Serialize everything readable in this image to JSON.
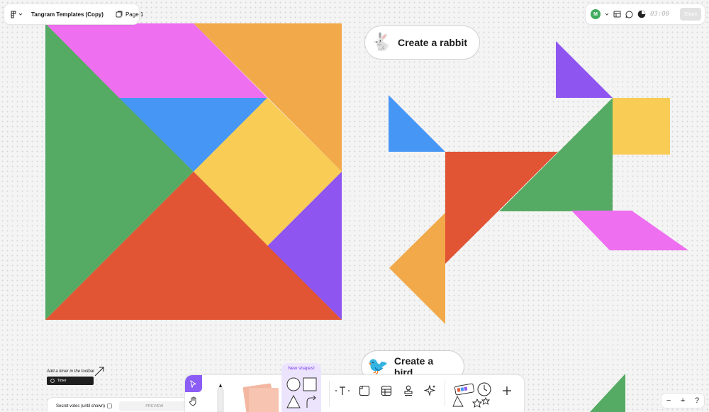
{
  "header": {
    "file_title": "Tangram Templates (Copy)",
    "page_label": "Page 1",
    "avatar_initial": "M",
    "timer_value": "03:00",
    "share_label": "Share"
  },
  "canvas": {
    "rabbit_label": "Create a rabbit",
    "rabbit_emoji": "🐇",
    "bird_label": "Create a bird",
    "bird_emoji": "🐦",
    "timer_hint": "Add a timer in the toolbar",
    "timer_chip_label": "Timer",
    "secret_votes_label": "Secret votes (until shown)",
    "preview_label": "PREVIEW"
  },
  "colors": {
    "green": "#55ab63",
    "magenta": "#ee6fef",
    "orange": "#f2a94a",
    "blue": "#4596f5",
    "yellow": "#f8cc55",
    "red": "#e15535",
    "purple": "#8f55f0",
    "accent": "#8b5cf6"
  },
  "toolbar": {
    "new_shapes_label": "New shapes!",
    "zoom_out_label": "−",
    "zoom_in_label": "+",
    "help_label": "?",
    "tools": [
      "cursor-icon",
      "hand-icon",
      "marker-icon",
      "sticky-note-icon",
      "circle-shape-icon",
      "square-shape-icon",
      "text-icon",
      "section-icon",
      "table-icon",
      "stamp-icon",
      "sparkle-icon",
      "widgets-icon",
      "timer-icon",
      "add-icon"
    ]
  }
}
